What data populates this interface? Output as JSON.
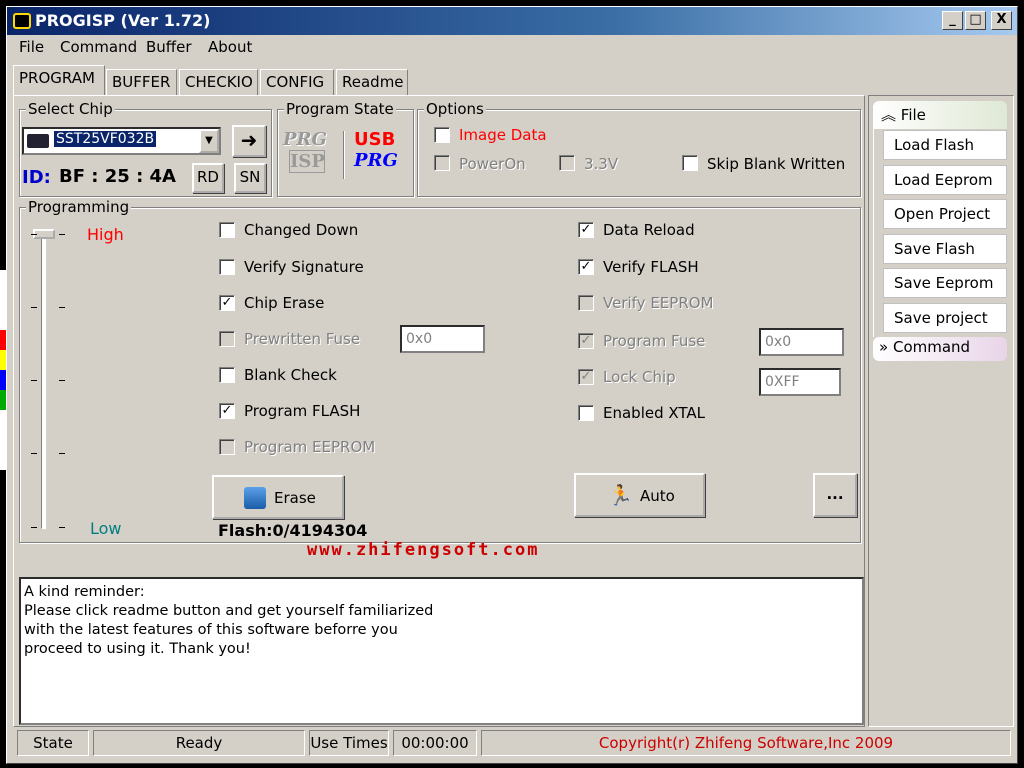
{
  "window": {
    "title": "PROGISP (Ver 1.72)",
    "caption_buttons": [
      "_",
      "□",
      "X"
    ]
  },
  "menu": [
    "File",
    "Command",
    "Buffer",
    "About"
  ],
  "tabs": [
    "PROGRAM",
    "BUFFER",
    "CHECKIO",
    "CONFIG",
    "Readme"
  ],
  "select_chip": {
    "label": "Select Chip",
    "chip": "SST25VF032B",
    "go_glyph": "➜",
    "id_label": "ID:",
    "id_value": "BF : 25 : 4A",
    "rd_label": "RD",
    "sn_label": "SN"
  },
  "program_state": {
    "label": "Program State",
    "logo1_top": "PRG",
    "logo1_bottom": "ISP",
    "logo2_top": "USB",
    "logo2_bottom": "PRG"
  },
  "options": {
    "label": "Options",
    "image_data": "Image Data",
    "poweron": "PowerOn",
    "v33": "3.3V",
    "skip_blank": "Skip Blank Written"
  },
  "programming": {
    "label": "Programming",
    "high": "High",
    "low": "Low",
    "left_col": [
      {
        "label": "Changed Down",
        "checked": false,
        "enabled": true
      },
      {
        "label": "Verify Signature",
        "checked": false,
        "enabled": true
      },
      {
        "label": "Chip Erase",
        "checked": true,
        "enabled": true
      },
      {
        "label": "Prewritten Fuse",
        "checked": false,
        "enabled": false
      },
      {
        "label": "Blank Check",
        "checked": false,
        "enabled": true
      },
      {
        "label": "Program FLASH",
        "checked": true,
        "enabled": true
      },
      {
        "label": "Program EEPROM",
        "checked": false,
        "enabled": false
      }
    ],
    "right_col": [
      {
        "label": "Data Reload",
        "checked": true,
        "enabled": true
      },
      {
        "label": "Verify FLASH",
        "checked": true,
        "enabled": true
      },
      {
        "label": "Verify EEPROM",
        "checked": false,
        "enabled": false
      },
      {
        "label": "Program Fuse",
        "checked": true,
        "enabled": false
      },
      {
        "label": "Lock Chip",
        "checked": true,
        "enabled": false
      },
      {
        "label": "Enabled XTAL",
        "checked": false,
        "enabled": true
      }
    ],
    "prewritten_fuse_value": "0x0",
    "program_fuse_value": "0x0",
    "lock_chip_value": "0XFF",
    "erase_label": "Erase",
    "auto_label": "Auto",
    "more_label": "...",
    "flash_status": "Flash:0/4194304"
  },
  "website": "www.zhifengsoft.com",
  "log_lines": [
    "A kind reminder:",
    "Please click readme button and get yourself familiarized",
    "with the latest features of this software beforre you",
    "proceed to using it. Thank you!"
  ],
  "sidebar": {
    "file_header": "File",
    "items": [
      "Load Flash",
      "Load Eeprom",
      "Open Project",
      "Save Flash",
      "Save Eeprom",
      "Save project"
    ],
    "command_header": "Command"
  },
  "statusbar": {
    "state_label": "State",
    "state_value": "Ready",
    "use_times_label": "Use Times",
    "time_value": "00:00:00",
    "copyright": "Copyright(r) Zhifeng Software,Inc 2009"
  },
  "colors": {
    "face": "#d4d0c8",
    "title_start": "#0a246a",
    "high_color": "#ff0000",
    "low_color": "#008080",
    "id_color": "#0000cc",
    "copyright_color": "#cc0000"
  }
}
